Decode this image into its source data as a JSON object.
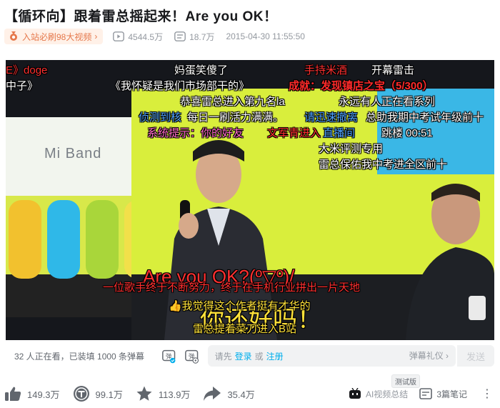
{
  "video": {
    "title": "【循环向】跟着雷总摇起来！Are you OK！",
    "rank_badge": "入站必刷98大视频",
    "rank_chevron": "›",
    "views": "4544.5万",
    "danmaku_total": "18.7万",
    "publish_time": "2015-04-30 11:55:50"
  },
  "frame": {
    "product_label": "Mi Band"
  },
  "danmaku": [
    {
      "text": "E》doge",
      "color": "#ff3030"
    },
    {
      "text": "妈蛋笑傻了",
      "color": "#ffffff"
    },
    {
      "text": "手持米酒",
      "color": "#ff3030"
    },
    {
      "text": "开幕雷击",
      "color": "#ffffff"
    },
    {
      "text": "中子》",
      "color": "#ffffff"
    },
    {
      "text": "《我怀疑是我们市场部干的》",
      "color": "#ffffff"
    },
    {
      "text": "成就：发现镇店之宝（5/300）",
      "color": "#ff2a2a"
    },
    {
      "text": "恭喜雷总进入第九名la",
      "color": "#ffffff"
    },
    {
      "text": "永远有人正在看系列",
      "color": "#ffffff"
    },
    {
      "text": "侦测到核",
      "color": "#4fa3ff"
    },
    {
      "text": "每日一刷活力满满。",
      "color": "#ffffff"
    },
    {
      "text": "请迅速撤离",
      "color": "#4fa3ff"
    },
    {
      "text": "总助我期中考试年级前十",
      "color": "#ffffff"
    },
    {
      "text": "系统提示：你的好友",
      "color": "#ff69c8"
    },
    {
      "text": "文军青进入",
      "color": "#ff3030"
    },
    {
      "text": "直播间",
      "color": "#4fa3ff"
    },
    {
      "text": "跳楼 00:51",
      "color": "#ffffff"
    },
    {
      "text": "大米评测专用",
      "color": "#ffffff"
    },
    {
      "text": "雷总保佑我中考进全区前十",
      "color": "#ffffff"
    },
    {
      "text": "Are you OK?(º▽º)/",
      "color": "#ff3030"
    },
    {
      "text": "一位歌手终于不断努力，终于在手机行业拼出一片天地",
      "color": "#ff3030"
    },
    {
      "text": "你还好吗！",
      "color": "#ffe23a"
    },
    {
      "text": "👍我觉得这个作者挺有才华的",
      "color": "#ffe23a"
    },
    {
      "text": "雷总提着菜刀进入B站",
      "color": "#ffe23a"
    }
  ],
  "danmaku_bar": {
    "status": "32 人正在看，已装填 1000 条弹幕",
    "prompt_prefix": "请先",
    "login_link": "登录",
    "or_text": "或",
    "register_link": "注册",
    "etiquette": "弹幕礼仪 ›",
    "send_button": "发送"
  },
  "ai_badge": "测试版",
  "toolbar": {
    "like": "149.3万",
    "coin": "99.1万",
    "favorite": "113.9万",
    "share": "35.4万",
    "ai_summary": "AI视频总结",
    "notes": "3篇笔记",
    "more": "⋮"
  },
  "colors": {
    "accent_blue": "#00aeec",
    "rank_orange": "#e5774a",
    "icon_gray": "#61666d"
  }
}
